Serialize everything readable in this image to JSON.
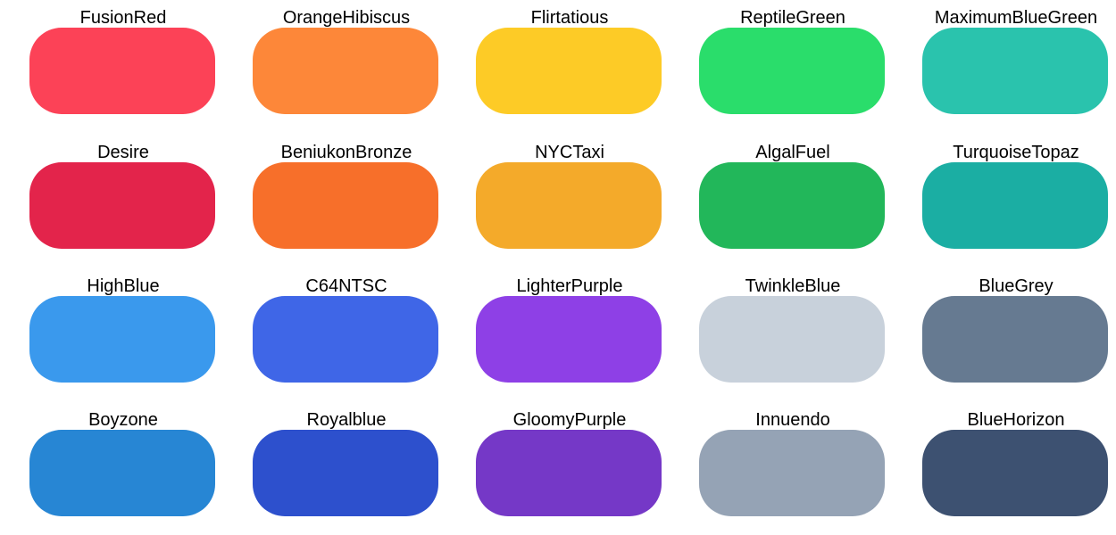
{
  "swatches": [
    {
      "name": "FusionRed",
      "color": "#fc4257"
    },
    {
      "name": "OrangeHibiscus",
      "color": "#fd8739"
    },
    {
      "name": "Flirtatious",
      "color": "#fdcb26"
    },
    {
      "name": "ReptileGreen",
      "color": "#2add6b"
    },
    {
      "name": "MaximumBlueGreen",
      "color": "#2ac3ad"
    },
    {
      "name": "Desire",
      "color": "#e3244b"
    },
    {
      "name": "BeniukonBronze",
      "color": "#f76f2a"
    },
    {
      "name": "NYCTaxi",
      "color": "#f4aa2a"
    },
    {
      "name": "AlgalFuel",
      "color": "#22b75a"
    },
    {
      "name": "TurquoiseTopaz",
      "color": "#1baea3"
    },
    {
      "name": "HighBlue",
      "color": "#3a99ed"
    },
    {
      "name": "C64NTSC",
      "color": "#3f66e7"
    },
    {
      "name": "LighterPurple",
      "color": "#8e40e6"
    },
    {
      "name": "TwinkleBlue",
      "color": "#c8d1db"
    },
    {
      "name": "BlueGrey",
      "color": "#667a91"
    },
    {
      "name": "Boyzone",
      "color": "#2786d4"
    },
    {
      "name": "Royalblue",
      "color": "#2d50cd"
    },
    {
      "name": "GloomyPurple",
      "color": "#7538c7"
    },
    {
      "name": "Innuendo",
      "color": "#95a3b5"
    },
    {
      "name": "BlueHorizon",
      "color": "#3d5171"
    }
  ]
}
